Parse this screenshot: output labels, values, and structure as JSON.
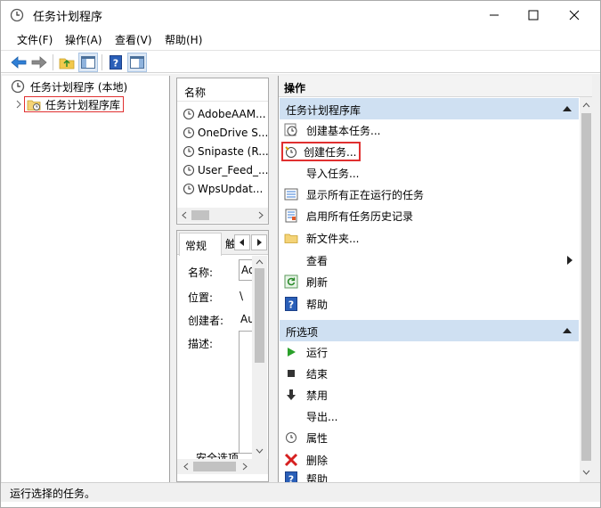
{
  "window": {
    "title": "任务计划程序",
    "icons": {
      "app": "clock-icon",
      "minimize": "minimize-icon",
      "maximize": "maximize-icon",
      "close": "close-icon"
    }
  },
  "menu": {
    "items": [
      {
        "label": "文件(F)"
      },
      {
        "label": "操作(A)"
      },
      {
        "label": "查看(V)"
      },
      {
        "label": "帮助(H)"
      }
    ]
  },
  "toolbar": {
    "buttons": [
      "back-arrow-icon",
      "forward-arrow-icon",
      "up-folder-icon",
      "show-hide-tree-icon",
      "help-icon",
      "show-hide-action-pane-icon"
    ]
  },
  "tree": {
    "root": {
      "label": "任务计划程序 (本地)"
    },
    "library": {
      "label": "任务计划程序库"
    }
  },
  "task_list": {
    "header": "名称",
    "rows": [
      {
        "name": "AdobeAAM..."
      },
      {
        "name": "OneDrive S..."
      },
      {
        "name": "Snipaste (R..."
      },
      {
        "name": "User_Feed_..."
      },
      {
        "name": "WpsUpdat..."
      }
    ]
  },
  "detail": {
    "tab_general": "常规",
    "tab_more": "触",
    "fields": [
      {
        "label": "名称:",
        "value": "Ad"
      },
      {
        "label": "位置:",
        "value": "\\"
      },
      {
        "label": "创建者:",
        "value": "Au"
      },
      {
        "label": "描述:",
        "value": ""
      }
    ],
    "security_label": "安全选项"
  },
  "actions": {
    "header": "操作",
    "library_section": {
      "title": "任务计划程序库",
      "items": [
        {
          "label": "创建基本任务...",
          "icon": "basic-task-wizard-icon"
        },
        {
          "label": "创建任务...",
          "icon": "create-task-icon"
        },
        {
          "label": "导入任务...",
          "icon": ""
        },
        {
          "label": "显示所有正在运行的任务",
          "icon": "running-tasks-icon"
        },
        {
          "label": "启用所有任务历史记录",
          "icon": "task-history-icon"
        },
        {
          "label": "新文件夹...",
          "icon": "folder-icon"
        },
        {
          "label": "查看",
          "icon": ""
        },
        {
          "label": "刷新",
          "icon": "refresh-icon"
        },
        {
          "label": "帮助",
          "icon": "help-icon"
        }
      ]
    },
    "selected_section": {
      "title": "所选项",
      "items": [
        {
          "label": "运行",
          "icon": "run-icon"
        },
        {
          "label": "结束",
          "icon": "stop-icon"
        },
        {
          "label": "禁用",
          "icon": "disable-icon"
        },
        {
          "label": "导出...",
          "icon": ""
        },
        {
          "label": "属性",
          "icon": "properties-icon"
        },
        {
          "label": "删除",
          "icon": "delete-icon"
        },
        {
          "label": "帮助",
          "icon": "help-icon"
        }
      ]
    }
  },
  "status": {
    "text": "运行选择的任务。"
  },
  "colors": {
    "accent_highlight": "#e03030",
    "section_header": "#cfe0f2"
  }
}
